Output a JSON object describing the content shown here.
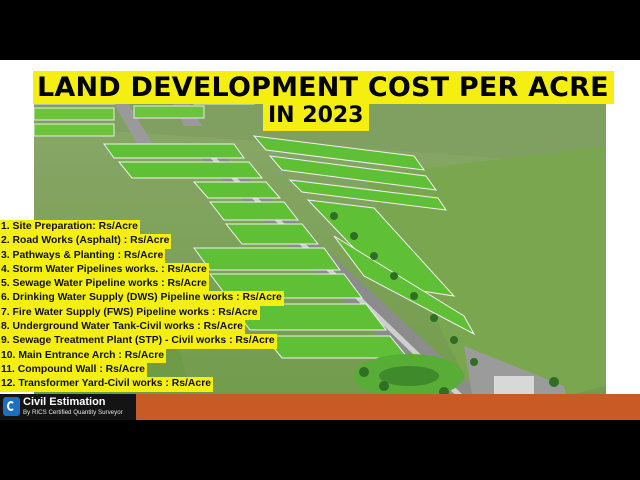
{
  "title": {
    "line1": "LAND DEVELOPMENT COST PER ACRE",
    "line2": "IN 2023"
  },
  "items": [
    "1. Site Preparation: Rs/Acre",
    "2. Road Works (Asphalt) : Rs/Acre",
    "3. Pathways & Planting : Rs/Acre",
    "4. Storm Water Pipelines works. : Rs/Acre",
    "5. Sewage Water Pipeline works : Rs/Acre",
    "6. Drinking Water Supply (DWS) Pipeline works : Rs/Acre",
    "7. Fire Water Supply (FWS) Pipeline works : Rs/Acre",
    "8. Underground Water Tank-Civil works : Rs/Acre",
    "9. Sewage Treatment Plant (STP) - Civil works : Rs/Acre",
    "10. Main Entrance Arch : Rs/Acre",
    "11. Compound Wall : Rs/Acre",
    "12. Transformer Yard-Civil works : Rs/Acre"
  ],
  "logo": {
    "name": "Civil Estimation",
    "tagline": "By RICS Certified Quantity Surveyor"
  },
  "colors": {
    "highlight": "#f4ef10",
    "brand_bar": "#c85a25",
    "logo_icon": "#1f6fc0"
  }
}
